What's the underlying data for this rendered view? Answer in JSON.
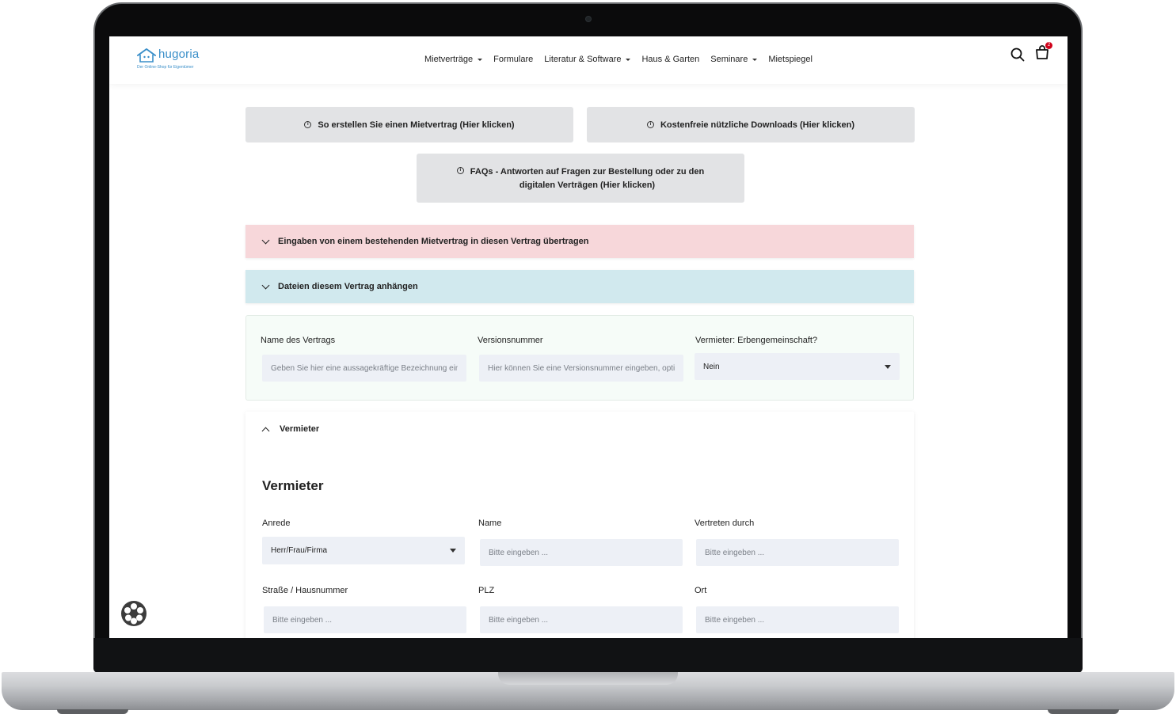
{
  "brand": {
    "name": "hugoria",
    "tagline": "Der Online-Shop für Eigentümer",
    "color": "#3a8fc9"
  },
  "nav": {
    "items": [
      {
        "label": "Mietverträge",
        "dropdown": true
      },
      {
        "label": "Formulare",
        "dropdown": false
      },
      {
        "label": "Literatur & Software",
        "dropdown": true
      },
      {
        "label": "Haus & Garten",
        "dropdown": false
      },
      {
        "label": "Seminare",
        "dropdown": true
      },
      {
        "label": "Mietspiegel",
        "dropdown": false
      }
    ],
    "cart_count": "2"
  },
  "info_buttons": {
    "howto": "So erstellen Sie einen Mietvertrag (Hier klicken)",
    "downloads": "Kostenfreie nützliche Downloads (Hier klicken)",
    "faq_line1": "FAQs - Antworten auf Fragen zur Bestellung oder zu den",
    "faq_line2": "digitalen Verträgen (Hier klicken)"
  },
  "accordions": {
    "transfer": {
      "label": "Eingaben von einem bestehenden Mietvertrag in diesen Vertrag übertragen",
      "color": "#f7d7da"
    },
    "attach": {
      "label": "Dateien diesem Vertrag anhängen",
      "color": "#d1e9ee"
    }
  },
  "contract": {
    "name_label": "Name des Vertrags",
    "name_placeholder": "Geben Sie hier eine aussagekräftige Bezeichnung ein",
    "version_label": "Versionsnummer",
    "version_placeholder": "Hier können Sie eine Versionsnummer eingeben, optional",
    "heirs_label": "Vermieter: Erbengemeinschaft?",
    "heirs_value": "Nein"
  },
  "vermieter": {
    "accordion_label": "Vermieter",
    "section_title": "Vermieter",
    "anrede_label": "Anrede",
    "anrede_value": "Herr/Frau/Firma",
    "name_label": "Name",
    "vertreten_label": "Vertreten durch",
    "strasse_label": "Straße / Hausnummer",
    "plz_label": "PLZ",
    "ort_label": "Ort",
    "placeholder": "Bitte eingeben ..."
  }
}
